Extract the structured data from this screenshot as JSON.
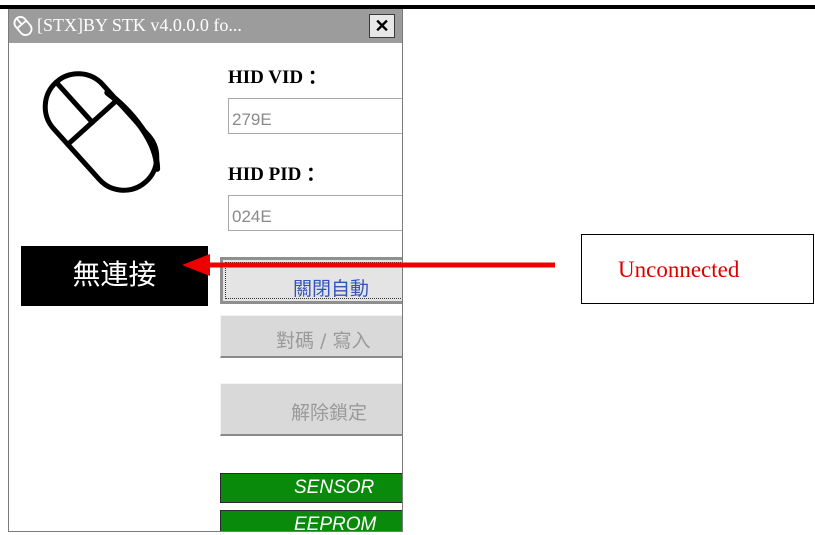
{
  "window": {
    "title": "[STX]BY STK v4.0.0.0 fo...",
    "close_label": "✕"
  },
  "fields": {
    "vid_label": "HID VID ：",
    "vid_value": "279E",
    "pid_label": "HID PID ：",
    "pid_value": "024E"
  },
  "status": {
    "text": "無連接"
  },
  "buttons": {
    "auto_label": "關閉自動",
    "pair_label": "對碼 / 寫入",
    "unlock_label": "解除鎖定"
  },
  "indicators": {
    "sensor_label": "SENSOR",
    "eeprom_label": "EEPROM"
  },
  "annotation": {
    "label": "Unconnected",
    "color": "#dd0000"
  },
  "icons": {
    "title": "mouse-icon",
    "main": "mouse-icon",
    "annotation": "arrow-left-icon"
  }
}
